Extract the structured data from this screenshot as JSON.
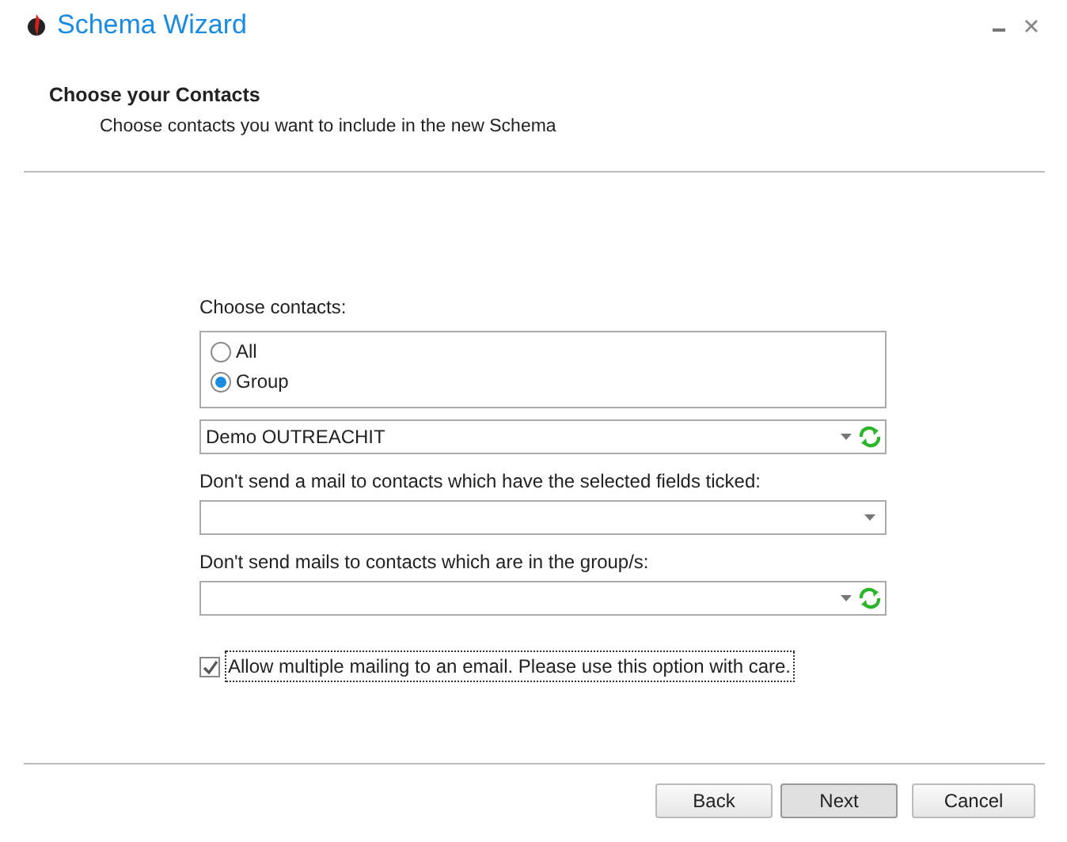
{
  "window": {
    "title": "Schema Wizard"
  },
  "header": {
    "title": "Choose your Contacts",
    "subtitle": "Choose contacts you want to include in the new Schema"
  },
  "contacts": {
    "label": "Choose contacts:",
    "options": [
      {
        "label": "All",
        "selected": false
      },
      {
        "label": "Group",
        "selected": true
      }
    ]
  },
  "fields": [
    {
      "value": "Demo OUTREACHIT",
      "refresh": true
    },
    {
      "label": "Don't send a mail to contacts which have the selected fields ticked:",
      "refresh": false
    },
    {
      "label": "Don't send mails to contacts which are in the group/s:",
      "refresh": true
    }
  ],
  "allow_multiple": {
    "label": "Allow multiple mailing to an email. Please use this option with care.",
    "checked": true,
    "focused": true
  },
  "buttons": [
    {
      "label": "Back",
      "default": false
    },
    {
      "label": "Next",
      "default": true
    },
    {
      "label": "Cancel",
      "default": false
    }
  ]
}
